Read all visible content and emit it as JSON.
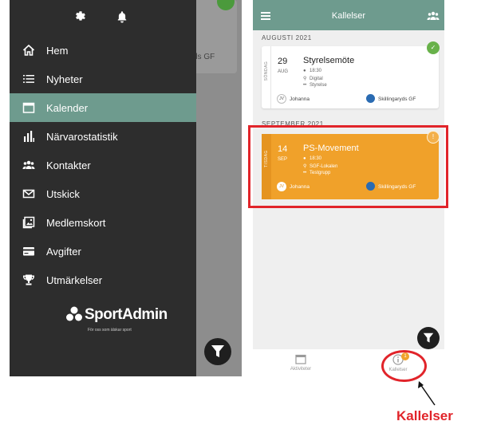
{
  "left_screen": {
    "background_card_text": "ds GF",
    "top_icons": [
      "gear-icon",
      "bell-icon"
    ],
    "menu": [
      {
        "label": "Hem",
        "icon": "home-icon",
        "active": false
      },
      {
        "label": "Nyheter",
        "icon": "news-list-icon",
        "active": false
      },
      {
        "label": "Kalender",
        "icon": "calendar-icon",
        "active": true
      },
      {
        "label": "Närvarostatistik",
        "icon": "bar-chart-icon",
        "active": false
      },
      {
        "label": "Kontakter",
        "icon": "group-icon",
        "active": false
      },
      {
        "label": "Utskick",
        "icon": "envelope-icon",
        "active": false
      },
      {
        "label": "Medlemskort",
        "icon": "member-card-icon",
        "active": false
      },
      {
        "label": "Avgifter",
        "icon": "credit-card-icon",
        "active": false
      },
      {
        "label": "Utmärkelser",
        "icon": "trophy-icon",
        "active": false
      }
    ],
    "brand": {
      "name": "SportAdmin",
      "tagline": "För oss som älskar sport"
    }
  },
  "right_screen": {
    "header_title": "Kallelser",
    "sections": [
      {
        "label": "AUGUSTI 2021",
        "event": {
          "day_name": "SÖNDAG",
          "day": "29",
          "month": "AUG",
          "title": "Styrelsemöte",
          "time": "18:30",
          "location": "Digital",
          "group": "Styrelse",
          "avatar_initials": "JV",
          "person": "Johanna",
          "club": "Skillingaryds GF",
          "status_icon": "check-icon",
          "status_symbol": "✓"
        }
      },
      {
        "label": "SEPTEMBER 2021",
        "event": {
          "day_name": "TISDAG",
          "day": "14",
          "month": "SEP",
          "title": "PS-Movement",
          "time": "18:30",
          "location": "SGF-Lokalen",
          "group": "Testgrupp",
          "avatar_initials": "JV",
          "person": "Johanna",
          "club": "Skillingaryds GF",
          "status_icon": "exclamation-icon",
          "status_symbol": "!"
        }
      }
    ],
    "bottom_tabs": [
      {
        "label": "Aktiviteter",
        "icon": "calendar-icon"
      },
      {
        "label": "Kallelser",
        "icon": "info-icon",
        "badge": "1"
      }
    ]
  },
  "annotation": {
    "label": "Kallelser",
    "color": "#e1242a"
  },
  "colors": {
    "accent": "#6e9b8e",
    "drawer": "#2d2d2d",
    "pending": "#f0a12a",
    "confirmed": "#68b14a"
  }
}
